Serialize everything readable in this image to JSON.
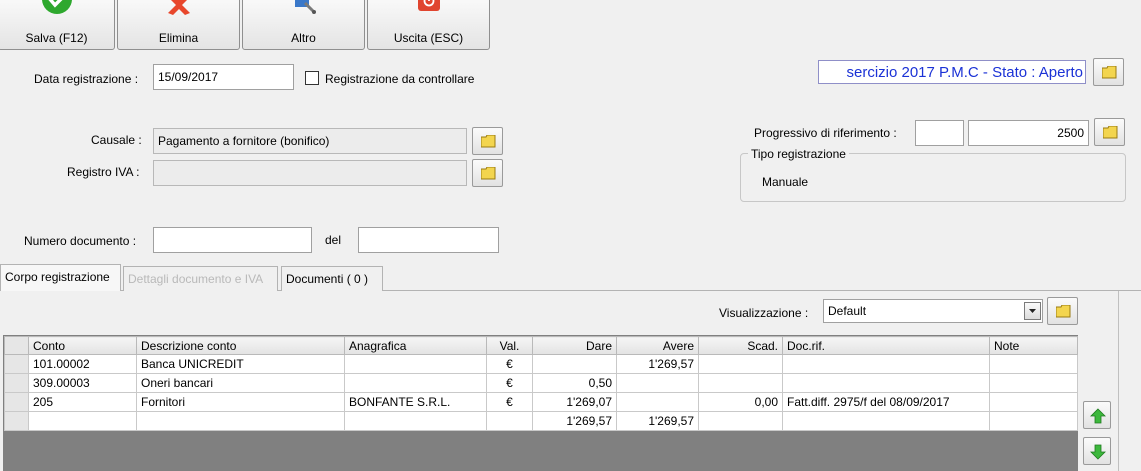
{
  "toolbar": {
    "save_label": "Salva (F12)",
    "delete_label": "Elimina",
    "other_label": "Altro",
    "exit_label": "Uscita (ESC)"
  },
  "form": {
    "date_label": "Data registrazione :",
    "date_value": "15/09/2017",
    "check_label": "Registrazione da controllare",
    "exercise_status": "sercizio 2017 P.M.C - Stato : Aperto",
    "causale_label": "Causale :",
    "causale_value": "Pagamento a fornitore (bonifico)",
    "registro_label": "Registro IVA :",
    "registro_value": "",
    "progressivo_label": "Progressivo di riferimento :",
    "progressivo_prefix": "",
    "progressivo_value": "2500",
    "tipo_title": "Tipo registrazione",
    "tipo_value": "Manuale",
    "numdoc_label": "Numero documento :",
    "numdoc_value": "",
    "del_label": "del",
    "del_value": ""
  },
  "tabs": [
    {
      "label": "Corpo registrazione"
    },
    {
      "label": "Dettagli documento e IVA"
    },
    {
      "label": "Documenti ( 0 )"
    }
  ],
  "view": {
    "label": "Visualizzazione :",
    "value": "Default"
  },
  "grid": {
    "headers": [
      "Conto",
      "Descrizione conto",
      "Anagrafica",
      "Val.",
      "Dare",
      "Avere",
      "Scad.",
      "Doc.rif.",
      "Note"
    ],
    "rows": [
      [
        "101.00002",
        "Banca UNICREDIT",
        "",
        "€",
        "",
        "1'269,57",
        "",
        "",
        ""
      ],
      [
        "309.00003",
        "Oneri bancari",
        "",
        "€",
        "0,50",
        "",
        "",
        "",
        ""
      ],
      [
        "205",
        "Fornitori",
        "BONFANTE S.R.L.",
        "€",
        "1'269,07",
        "",
        "0,00",
        "Fatt.diff. 2975/f del 08/09/2017",
        ""
      ],
      [
        "",
        "",
        "",
        "",
        "1'269,57",
        "1'269,57",
        "",
        "",
        ""
      ]
    ]
  },
  "colors": {
    "status_text": "#1b32d6",
    "status_bg": "#ffffff",
    "grid_bg": "#808080",
    "arrow_green": "#3cb83c"
  }
}
